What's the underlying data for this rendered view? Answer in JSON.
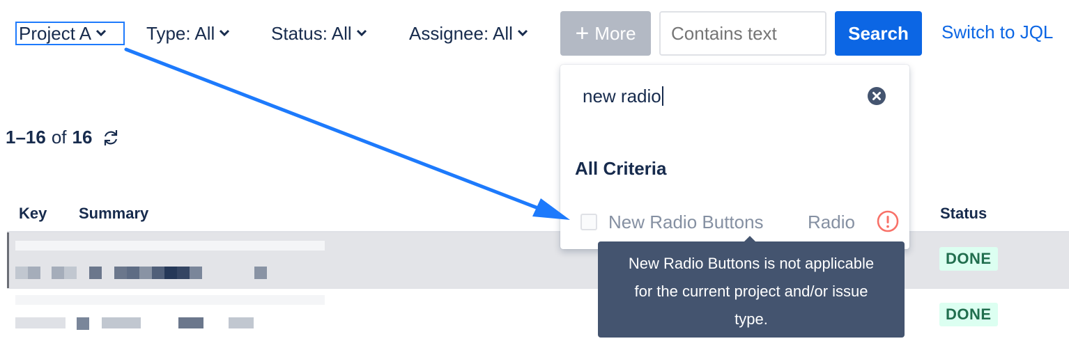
{
  "filters": {
    "project": "Project A",
    "type": "Type: All",
    "status": "Status: All",
    "assignee": "Assignee: All",
    "more_label": "More",
    "text_placeholder": "Contains text",
    "search_label": "Search",
    "jql_link": "Switch to JQL"
  },
  "results": {
    "range": "1–16",
    "of_label": "of",
    "total": "16"
  },
  "table": {
    "col_key": "Key",
    "col_summary": "Summary",
    "col_status": "Status",
    "rows": [
      {
        "status": "DONE"
      },
      {
        "status": "DONE"
      }
    ]
  },
  "more_panel": {
    "search_value": "new radio",
    "heading": "All Criteria",
    "option_label": "New Radio Buttons",
    "option_type": "Radio"
  },
  "tooltip": {
    "line1": "New Radio Buttons is not applicable",
    "line2": "for the current project and/or issue",
    "line3": "type."
  },
  "icons": [
    "chevron-down-icon",
    "plus-icon",
    "refresh-icon",
    "clear-icon",
    "warning-icon"
  ],
  "colors": {
    "primary": "#0c66e4",
    "annotation_arrow": "#1d7afc",
    "done_bg": "#dcfff1",
    "done_text": "#216e4e",
    "tooltip_bg": "#44546f",
    "warning": "#f87168"
  }
}
